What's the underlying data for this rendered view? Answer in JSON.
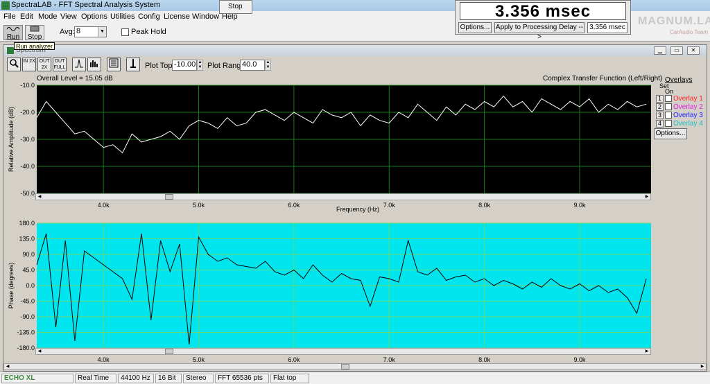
{
  "window": {
    "title": "SpectraLAB - FFT Spectral Analysis System"
  },
  "menu": [
    "File",
    "Edit",
    "Mode",
    "View",
    "Options",
    "Utilities",
    "Config",
    "License",
    "Window",
    "Help"
  ],
  "toolbar": {
    "run_label": "Run",
    "stop_label": "Stop",
    "avg_label": "Avg:",
    "avg_value": "8",
    "peak_hold_label": "Peak Hold",
    "tooltip": "Run analyzer"
  },
  "stop_float": {
    "label": "Stop"
  },
  "delay_panel": {
    "display": "3.356 msec",
    "options_label": "Options...",
    "apply_label": "Apply to Processing Delay -->",
    "value_label": "3.356 msec"
  },
  "watermark": {
    "big": "MAGNUM.LA",
    "small": "CarAudio Team"
  },
  "spectrum": {
    "title": "Spectrum",
    "tools": [
      "IN 2X",
      "OUT 2X",
      "OUT FULL"
    ],
    "plot_top_label": "Plot Top:",
    "plot_top_value": "-10.00",
    "plot_range_label": "Plot Range:",
    "plot_range_value": "40.0",
    "overall_level": "Overall Level = 15.05 dB",
    "plot_title": "Complex Transfer Function (Left/Right)",
    "overlays": {
      "header": "Overlays",
      "set_label": "Set",
      "on_label": "On",
      "items": [
        {
          "num": "1",
          "label": "Overlay 1",
          "color": "#ff2020"
        },
        {
          "num": "2",
          "label": "Overlay 2",
          "color": "#e020e0"
        },
        {
          "num": "3",
          "label": "Overlay 3",
          "color": "#2020ff"
        },
        {
          "num": "4",
          "label": "Overlay 4",
          "color": "#20c0c0"
        }
      ],
      "options_label": "Options..."
    }
  },
  "chart_data": [
    {
      "type": "line",
      "ylabel": "Relative Amplitude (dB)",
      "xlabel": "Frequency (Hz)",
      "xlim": [
        3.3,
        9.75
      ],
      "ylim": [
        -50,
        -10
      ],
      "x_ticks": [
        "4.0k",
        "5.0k",
        "6.0k",
        "7.0k",
        "8.0k",
        "9.0k"
      ],
      "y_ticks": [
        "-10.0",
        "-20.0",
        "-30.0",
        "-40.0",
        "-50.0"
      ],
      "grid": true,
      "background": "#000000",
      "line_color": "#ffffff",
      "x": [
        3.3,
        3.4,
        3.5,
        3.6,
        3.7,
        3.8,
        3.9,
        4.0,
        4.1,
        4.2,
        4.3,
        4.4,
        4.5,
        4.6,
        4.7,
        4.8,
        4.9,
        5.0,
        5.1,
        5.2,
        5.3,
        5.4,
        5.5,
        5.6,
        5.7,
        5.8,
        5.9,
        6.0,
        6.1,
        6.2,
        6.3,
        6.4,
        6.5,
        6.6,
        6.7,
        6.8,
        6.9,
        7.0,
        7.1,
        7.2,
        7.3,
        7.4,
        7.5,
        7.6,
        7.7,
        7.8,
        7.9,
        8.0,
        8.1,
        8.2,
        8.3,
        8.4,
        8.5,
        8.6,
        8.7,
        8.8,
        8.9,
        9.0,
        9.1,
        9.2,
        9.3,
        9.4,
        9.5,
        9.6,
        9.7
      ],
      "values": [
        -22,
        -16,
        -20,
        -24,
        -28,
        -27,
        -30,
        -33,
        -32,
        -35,
        -28,
        -31,
        -30,
        -29,
        -27,
        -30,
        -25,
        -23,
        -24,
        -26,
        -22,
        -25,
        -24,
        -20,
        -19,
        -21,
        -23,
        -20,
        -22,
        -24,
        -19,
        -21,
        -22,
        -20,
        -25,
        -21,
        -23,
        -24,
        -20,
        -22,
        -17,
        -20,
        -23,
        -18,
        -21,
        -17,
        -19,
        -16,
        -18,
        -14,
        -18,
        -16,
        -20,
        -15,
        -17,
        -19,
        -16,
        -18,
        -15,
        -20,
        -17,
        -19,
        -16,
        -18,
        -17
      ]
    },
    {
      "type": "line",
      "ylabel": "Phase (degrees)",
      "xlim": [
        3.3,
        9.75
      ],
      "ylim": [
        -180,
        180
      ],
      "x_ticks": [
        "4.0k",
        "5.0k",
        "6.0k",
        "7.0k",
        "8.0k",
        "9.0k"
      ],
      "y_ticks": [
        "180.0",
        "135.0",
        "90.0",
        "45.0",
        "0.0",
        "-45.0",
        "-90.0",
        "-135.0",
        "-180.0"
      ],
      "grid": true,
      "background": "#00e5ee",
      "line_color": "#000000",
      "x": [
        3.3,
        3.4,
        3.5,
        3.6,
        3.7,
        3.8,
        3.9,
        4.0,
        4.1,
        4.2,
        4.3,
        4.4,
        4.5,
        4.6,
        4.7,
        4.8,
        4.9,
        5.0,
        5.1,
        5.2,
        5.3,
        5.4,
        5.5,
        5.6,
        5.7,
        5.8,
        5.9,
        6.0,
        6.1,
        6.2,
        6.3,
        6.4,
        6.5,
        6.6,
        6.7,
        6.8,
        6.9,
        7.0,
        7.1,
        7.2,
        7.3,
        7.4,
        7.5,
        7.6,
        7.7,
        7.8,
        7.9,
        8.0,
        8.1,
        8.2,
        8.3,
        8.4,
        8.5,
        8.6,
        8.7,
        8.8,
        8.9,
        9.0,
        9.1,
        9.2,
        9.3,
        9.4,
        9.5,
        9.6,
        9.7
      ],
      "values": [
        60,
        150,
        -120,
        130,
        -160,
        100,
        80,
        60,
        40,
        20,
        -40,
        150,
        -100,
        130,
        40,
        120,
        -170,
        140,
        90,
        70,
        80,
        60,
        55,
        50,
        70,
        40,
        30,
        45,
        20,
        60,
        30,
        10,
        35,
        20,
        15,
        -60,
        25,
        20,
        10,
        130,
        40,
        30,
        50,
        15,
        25,
        30,
        10,
        20,
        0,
        15,
        5,
        -10,
        10,
        -5,
        20,
        0,
        -10,
        5,
        -15,
        0,
        -20,
        -10,
        -35,
        -80,
        20
      ]
    }
  ],
  "statusbar": [
    "ECHO XL",
    "Real Time",
    "44100 Hz",
    "16 Bit",
    "Stereo",
    "FFT 65536 pts",
    "Flat top"
  ]
}
